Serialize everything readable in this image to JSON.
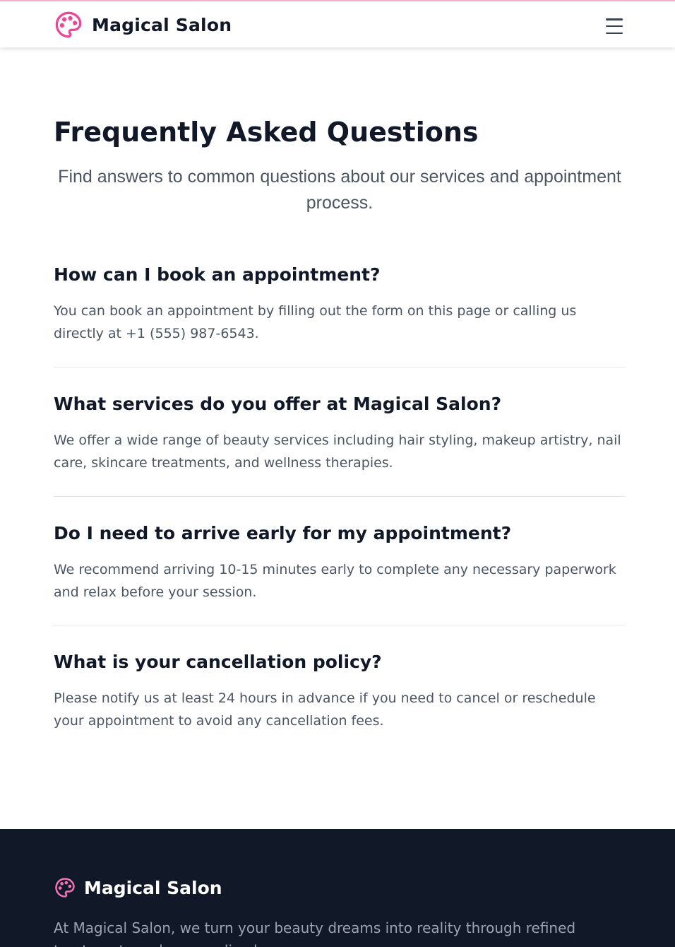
{
  "header": {
    "brand_name": "Magical Salon",
    "logo_icon": "palette-icon",
    "menu_icon": "hamburger-menu-icon"
  },
  "faq_section": {
    "title": "Frequently Asked Questions",
    "subtitle": "Find answers to common questions about our services and appointment process.",
    "items": [
      {
        "question": "How can I book an appointment?",
        "answer": "You can book an appointment by filling out the form on this page or calling us directly at +1 (555) 987-6543."
      },
      {
        "question": "What services do you offer at Magical Salon?",
        "answer": "We offer a wide range of beauty services including hair styling, makeup artistry, nail care, skincare treatments, and wellness therapies."
      },
      {
        "question": "Do I need to arrive early for my appointment?",
        "answer": "We recommend arriving 10-15 minutes early to complete any necessary paperwork and relax before your session."
      },
      {
        "question": "What is your cancellation policy?",
        "answer": "Please notify us at least 24 hours in advance if you need to cancel or reschedule your appointment to avoid any cancellation fees."
      }
    ]
  },
  "footer": {
    "brand_name": "Magical Salon",
    "about": "At Magical Salon, we turn your beauty dreams into reality through refined treatments and personalized care."
  },
  "colors": {
    "accent_pink": "#ec4899",
    "heading": "#111827",
    "body_text": "#4b5563",
    "footer_bg": "#111827"
  }
}
